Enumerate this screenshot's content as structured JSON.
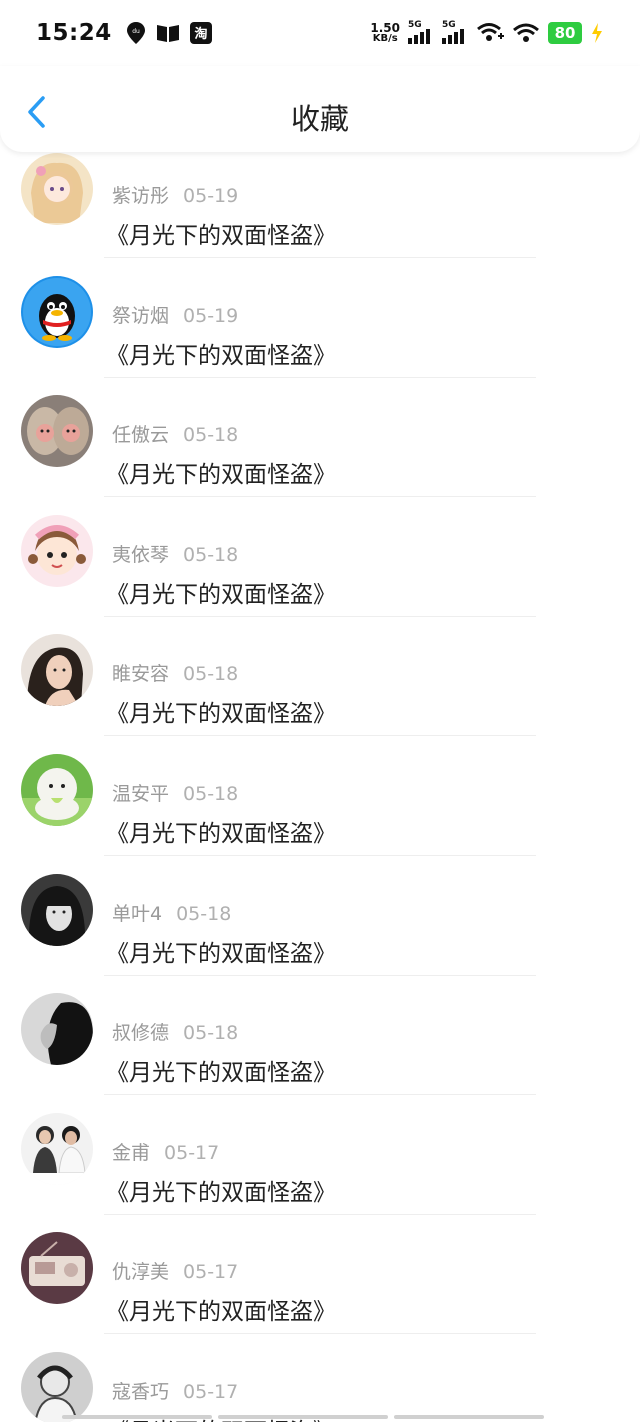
{
  "status_bar": {
    "time": "15:24",
    "net_speed_value": "1.50",
    "net_speed_unit": "KB/s",
    "signal1_label": "5G",
    "signal2_label": "5G",
    "battery": "80",
    "icons": [
      "baidu-map-icon",
      "book-icon",
      "taobao-icon",
      "wifi-plus-icon",
      "wifi-icon",
      "charging-icon"
    ]
  },
  "header": {
    "title": "收藏",
    "back_icon": "chevron-left-icon"
  },
  "colors": {
    "accent": "#2a9df4",
    "meta_text": "#9a9a9a",
    "title_text": "#222222",
    "battery": "#2ecc40",
    "charging": "#ffcc00"
  },
  "favorites": [
    {
      "user": "紫访彤",
      "date": "05-19",
      "title": "《月光下的双面怪盗》",
      "avatar": "anime-girl-avatar"
    },
    {
      "user": "祭访烟",
      "date": "05-19",
      "title": "《月光下的双面怪盗》",
      "avatar": "qq-penguin-avatar"
    },
    {
      "user": "任傲云",
      "date": "05-18",
      "title": "《月光下的双面怪盗》",
      "avatar": "monkeys-avatar"
    },
    {
      "user": "夷依琴",
      "date": "05-18",
      "title": "《月光下的双面怪盗》",
      "avatar": "cartoon-girl-avatar"
    },
    {
      "user": "睢安容",
      "date": "05-18",
      "title": "《月光下的双面怪盗》",
      "avatar": "woman-photo-avatar"
    },
    {
      "user": "温安平",
      "date": "05-18",
      "title": "《月光下的双面怪盗》",
      "avatar": "plush-toy-avatar"
    },
    {
      "user": "单叶4",
      "date": "05-18",
      "title": "《月光下的双面怪盗》",
      "avatar": "bw-girl-avatar"
    },
    {
      "user": "叔修德",
      "date": "05-18",
      "title": "《月光下的双面怪盗》",
      "avatar": "bw-profile-avatar"
    },
    {
      "user": "金甫",
      "date": "05-17",
      "title": "《月光下的双面怪盗》",
      "avatar": "couple-photo-avatar"
    },
    {
      "user": "仇淳美",
      "date": "05-17",
      "title": "《月光下的双面怪盗》",
      "avatar": "radio-avatar"
    },
    {
      "user": "寇香巧",
      "date": "05-17",
      "title": "《月光下的双面怪盗》",
      "avatar": "sketch-avatar"
    }
  ]
}
